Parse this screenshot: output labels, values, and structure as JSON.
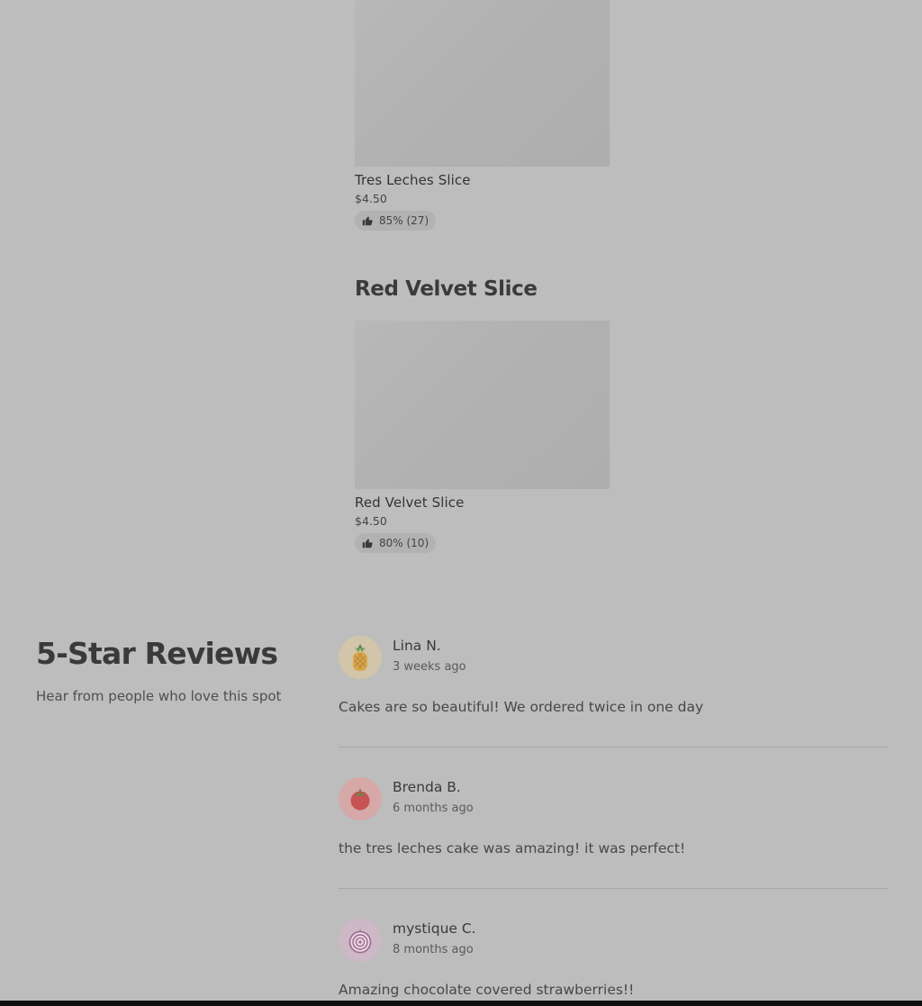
{
  "menu": {
    "items": [
      {
        "name": "Tres Leches Slice",
        "price": "$4.50",
        "rating": "85% (27)"
      },
      {
        "name": "Red Velvet Slice",
        "price": "$4.50",
        "rating": "80% (10)"
      }
    ],
    "category_title": "Red Velvet Slice"
  },
  "reviews": {
    "title": "5-Star Reviews",
    "subtitle": "Hear from people who love this spot",
    "list": [
      {
        "name": "Lina N.",
        "time": "3 weeks ago",
        "text": "Cakes are so beautiful! We ordered twice in one day",
        "avatar_icon": "pineapple-icon",
        "avatar_color": "#d2c5a9"
      },
      {
        "name": "Brenda B.",
        "time": "6 months ago",
        "text": "the tres leches cake was amazing! it was perfect!",
        "avatar_icon": "tomato-icon",
        "avatar_color": "#d6a8a8"
      },
      {
        "name": "mystique C.",
        "time": "8 months ago",
        "text": "Amazing chocolate covered strawberries!!",
        "avatar_icon": "onion-icon",
        "avatar_color": "#cdb8c6"
      }
    ]
  },
  "colors": {
    "overlay_background": "#bdbdbd",
    "chip_background": "#b2b2b2"
  }
}
